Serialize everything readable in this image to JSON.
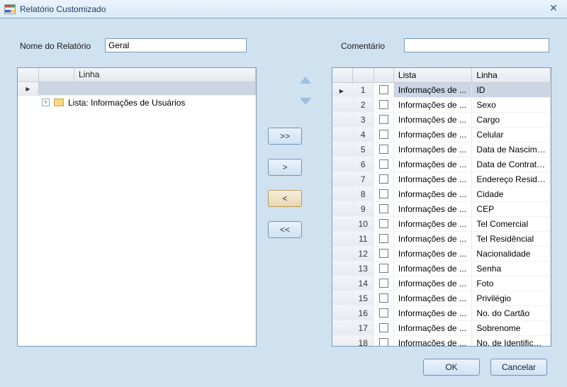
{
  "window": {
    "title": "Relatório Customizado",
    "close_glyph": "✕"
  },
  "form": {
    "name_label": "Nome do Relatório",
    "name_value": "Geral",
    "comment_label": "Comentário",
    "comment_value": ""
  },
  "left_panel": {
    "columns": {
      "blank": "",
      "linha": "Linha"
    },
    "selected_pointer": "▶",
    "tree_item": {
      "expander": "+",
      "label": "Lista: Informações de Usuários"
    }
  },
  "mover": {
    "add_all": ">>",
    "add_one": ">",
    "remove_one": "<",
    "remove_all": "<<"
  },
  "right_panel": {
    "columns": {
      "blank1": "",
      "blank2": "",
      "blank3": "",
      "lista": "Lista",
      "linha": "Linha"
    },
    "lista_text": "Informações de ...",
    "rows": [
      {
        "n": 1,
        "linha": "ID",
        "selected": true,
        "pointer": true
      },
      {
        "n": 2,
        "linha": "Sexo"
      },
      {
        "n": 3,
        "linha": "Cargo"
      },
      {
        "n": 4,
        "linha": "Celular"
      },
      {
        "n": 5,
        "linha": "Data de Nascime..."
      },
      {
        "n": 6,
        "linha": "Data de Contrata..."
      },
      {
        "n": 7,
        "linha": "Endereço Reside..."
      },
      {
        "n": 8,
        "linha": "Cidade"
      },
      {
        "n": 9,
        "linha": "CEP"
      },
      {
        "n": 10,
        "linha": "Tel Comercial"
      },
      {
        "n": 11,
        "linha": "Tel Residêncial"
      },
      {
        "n": 12,
        "linha": "Nacionalidade"
      },
      {
        "n": 13,
        "linha": "Senha"
      },
      {
        "n": 14,
        "linha": "Foto"
      },
      {
        "n": 15,
        "linha": "Privilégio"
      },
      {
        "n": 16,
        "linha": "No. do Cartão"
      },
      {
        "n": 17,
        "linha": "Sobrenome"
      },
      {
        "n": 18,
        "linha": "No. de Identificac..."
      }
    ]
  },
  "footer": {
    "ok": "OK",
    "cancel": "Cancelar"
  }
}
